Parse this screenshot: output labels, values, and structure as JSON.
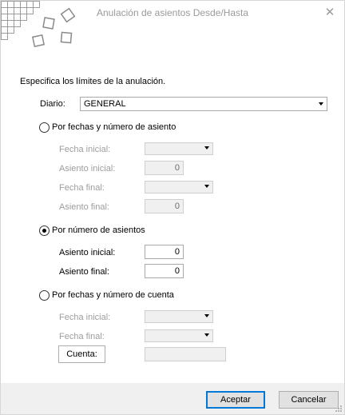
{
  "window": {
    "title": "Anulación de asientos Desde/Hasta",
    "close_symbol": "✕"
  },
  "heading": "Especifica los límites de la anulación.",
  "diario": {
    "label": "Diario:",
    "value": "GENERAL"
  },
  "group_fechas_asiento": {
    "label": "Por fechas y número de asiento",
    "selected": false,
    "fecha_inicial_label": "Fecha inicial:",
    "fecha_inicial_value": "",
    "asiento_inicial_label": "Asiento inicial:",
    "asiento_inicial_value": "0",
    "fecha_final_label": "Fecha final:",
    "fecha_final_value": "",
    "asiento_final_label": "Asiento final:",
    "asiento_final_value": "0"
  },
  "group_numero_asientos": {
    "label": "Por número de asientos",
    "selected": true,
    "asiento_inicial_label": "Asiento inicial:",
    "asiento_inicial_value": "0",
    "asiento_final_label": "Asiento final:",
    "asiento_final_value": "0"
  },
  "group_fechas_cuenta": {
    "label": "Por fechas y número de cuenta",
    "selected": false,
    "fecha_inicial_label": "Fecha inicial:",
    "fecha_inicial_value": "",
    "fecha_final_label": "Fecha final:",
    "fecha_final_value": "",
    "cuenta_button_label": "Cuenta:",
    "cuenta_value": ""
  },
  "buttons": {
    "accept": "Aceptar",
    "cancel": "Cancelar"
  },
  "colors": {
    "disabled_text": "#9d9d9d",
    "disabled_field": "#f0f0f0",
    "title_text": "#9a9a9a"
  }
}
